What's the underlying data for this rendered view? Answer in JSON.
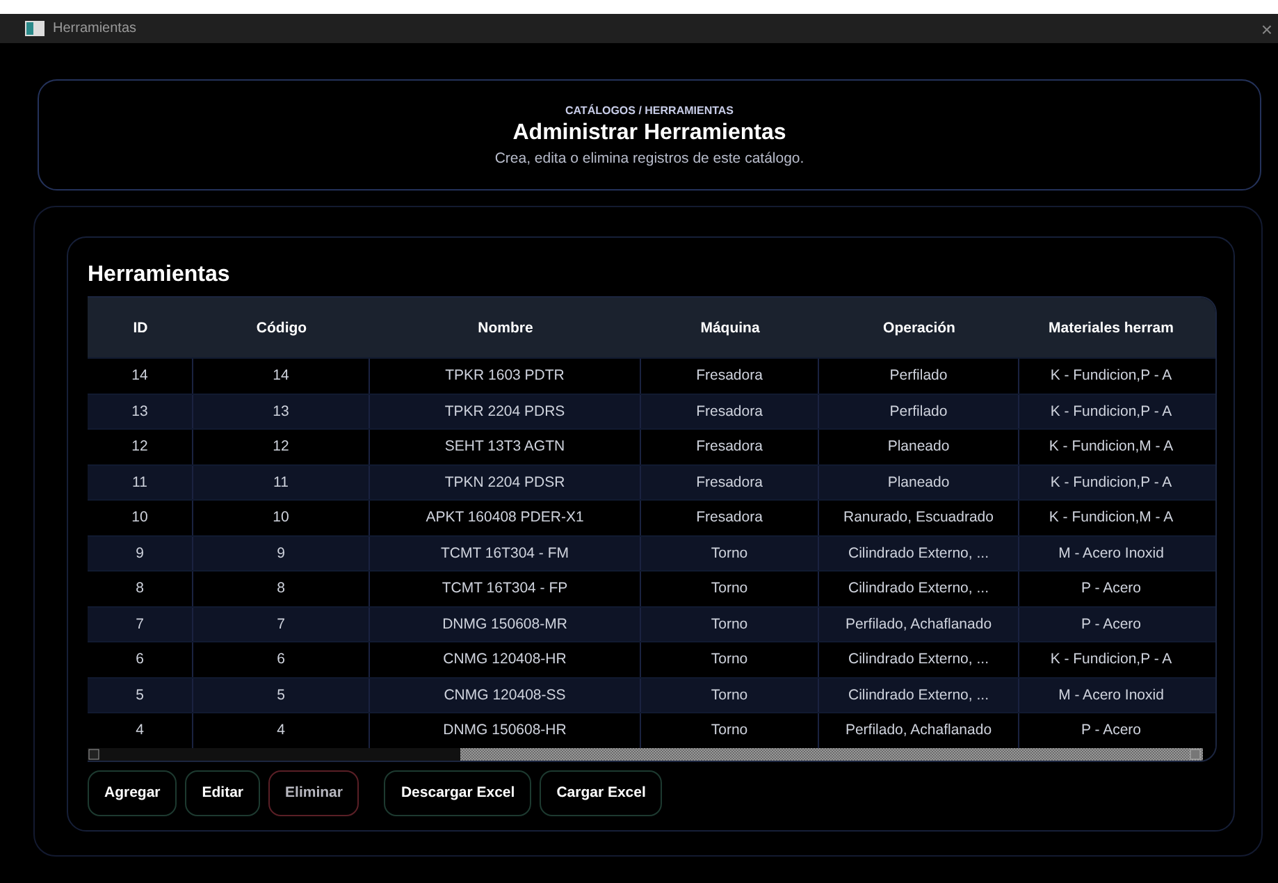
{
  "window": {
    "title": "Herramientas",
    "close": "×"
  },
  "header": {
    "breadcrumb": "CATÁLOGOS / HERRAMIENTAS",
    "title": "Administrar Herramientas",
    "subtitle": "Crea, edita o elimina registros de este catálogo."
  },
  "section": {
    "title": "Herramientas"
  },
  "table": {
    "columns": [
      "ID",
      "Código",
      "Nombre",
      "Máquina",
      "Operación",
      "Materiales herram"
    ],
    "rows": [
      [
        "14",
        "14",
        "TPKR 1603 PDTR",
        "Fresadora",
        "Perfilado",
        "K - Fundicion,P - A"
      ],
      [
        "13",
        "13",
        "TPKR 2204 PDRS",
        "Fresadora",
        "Perfilado",
        "K - Fundicion,P - A"
      ],
      [
        "12",
        "12",
        "SEHT 13T3 AGTN",
        "Fresadora",
        "Planeado",
        "K - Fundicion,M - A"
      ],
      [
        "11",
        "11",
        "TPKN 2204 PDSR",
        "Fresadora",
        "Planeado",
        "K - Fundicion,P - A"
      ],
      [
        "10",
        "10",
        "APKT 160408 PDER-X1",
        "Fresadora",
        "Ranurado, Escuadrado",
        "K - Fundicion,M - A"
      ],
      [
        "9",
        "9",
        "TCMT 16T304 - FM",
        "Torno",
        "Cilindrado Externo, ...",
        "M - Acero Inoxid"
      ],
      [
        "8",
        "8",
        "TCMT 16T304 - FP",
        "Torno",
        "Cilindrado Externo, ...",
        "P - Acero"
      ],
      [
        "7",
        "7",
        "DNMG 150608-MR",
        "Torno",
        "Perfilado, Achaflanado",
        "P - Acero"
      ],
      [
        "6",
        "6",
        "CNMG 120408-HR",
        "Torno",
        "Cilindrado Externo, ...",
        "K - Fundicion,P - A"
      ],
      [
        "5",
        "5",
        "CNMG 120408-SS",
        "Torno",
        "Cilindrado Externo, ...",
        "M - Acero Inoxid"
      ],
      [
        "4",
        "4",
        "DNMG 150608-HR",
        "Torno",
        "Perfilado, Achaflanado",
        "P - Acero"
      ]
    ]
  },
  "actions": [
    {
      "label": "Agregar",
      "kind": "normal"
    },
    {
      "label": "Editar",
      "kind": "normal"
    },
    {
      "label": "Eliminar",
      "kind": "danger"
    }
  ],
  "excel_actions": [
    {
      "label": "Descargar Excel"
    },
    {
      "label": "Cargar Excel"
    }
  ]
}
